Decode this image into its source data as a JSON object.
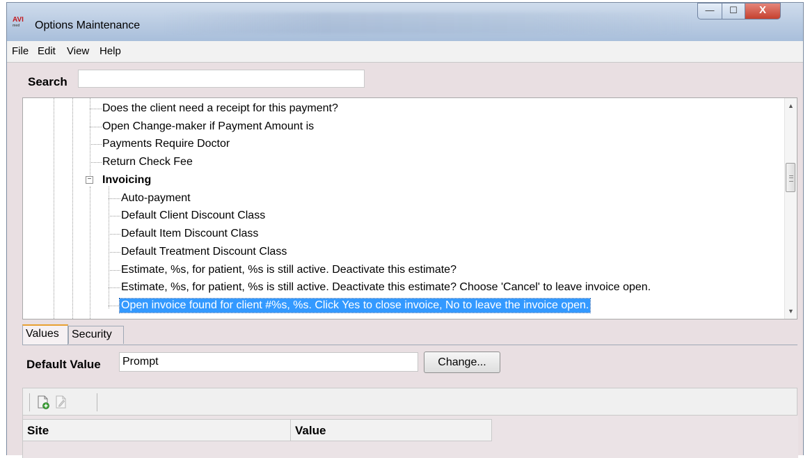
{
  "window": {
    "title": "Options Maintenance",
    "icon_text": "AVI",
    "controls": {
      "minimize": "—",
      "maximize": "☐",
      "close": "X"
    }
  },
  "menu": [
    "File",
    "Edit",
    "View",
    "Help"
  ],
  "search": {
    "label": "Search",
    "value": ""
  },
  "tree": {
    "items": [
      {
        "label": "Does the client need a receipt for this payment?",
        "level": 2
      },
      {
        "label": "Open Change-maker if Payment Amount is",
        "level": 2
      },
      {
        "label": "Payments Require Doctor",
        "level": 2
      },
      {
        "label": "Return Check Fee",
        "level": 2
      },
      {
        "label": "Invoicing",
        "level": 1,
        "expanded": true
      },
      {
        "label": "Auto-payment",
        "level": 2
      },
      {
        "label": "Default Client Discount Class",
        "level": 2
      },
      {
        "label": "Default Item Discount Class",
        "level": 2
      },
      {
        "label": "Default Treatment Discount Class",
        "level": 2
      },
      {
        "label": "Estimate, %s, for patient, %s is still active.  Deactivate this estimate?",
        "level": 2
      },
      {
        "label": "Estimate, %s, for patient, %s is still active.  Deactivate this estimate?  Choose 'Cancel' to leave invoice open.",
        "level": 2
      },
      {
        "label": "Open invoice found for client #%s, %s. Click Yes to close invoice, No to leave the invoice open.",
        "level": 2,
        "selected": true
      }
    ],
    "expander_symbol": "−",
    "selection_color": "#3399ff"
  },
  "tabs": [
    {
      "label": "Values",
      "active": true
    },
    {
      "label": "Security",
      "active": false
    }
  ],
  "default_value": {
    "label": "Default Value",
    "value": "Prompt",
    "button_label": "Change..."
  },
  "grid": {
    "columns": [
      "Site",
      "Value"
    ],
    "toolbar_icons": [
      "add-record-icon",
      "edit-record-icon"
    ]
  }
}
